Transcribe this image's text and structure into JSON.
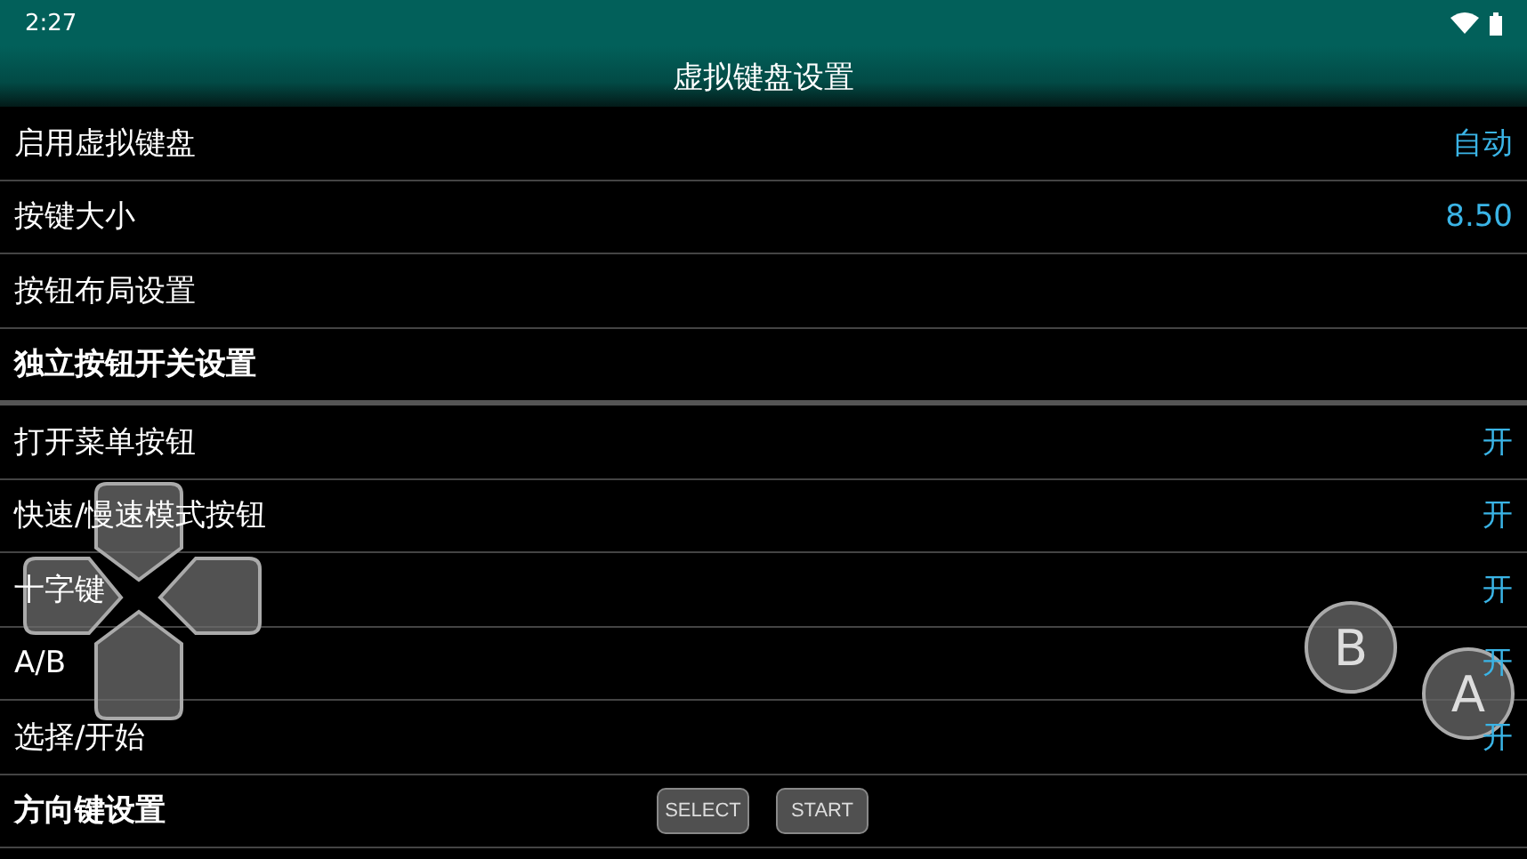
{
  "status_bar": {
    "time": "2:27"
  },
  "window": {
    "title": "虚拟键盘设置"
  },
  "rows": [
    {
      "kind": "setting",
      "label": "启用虚拟键盘",
      "value": "自动"
    },
    {
      "kind": "setting",
      "label": "按键大小",
      "value": "8.50"
    },
    {
      "kind": "setting",
      "label": "按钮布局设置"
    },
    {
      "kind": "header",
      "label": "独立按钮开关设置"
    },
    {
      "kind": "setting",
      "label": "打开菜单按钮",
      "value": "开"
    },
    {
      "kind": "setting",
      "label": "快速/慢速模式按钮",
      "value": "开"
    },
    {
      "kind": "setting",
      "label": "十字键",
      "value": "开"
    },
    {
      "kind": "setting",
      "label": "A/B",
      "value": "开"
    },
    {
      "kind": "setting",
      "label": "选择/开始",
      "value": "开"
    },
    {
      "kind": "header",
      "label": "方向键设置"
    }
  ],
  "gamepad": {
    "round_buttons": [
      "B",
      "A"
    ],
    "small_buttons": [
      "SELECT",
      "START"
    ]
  }
}
